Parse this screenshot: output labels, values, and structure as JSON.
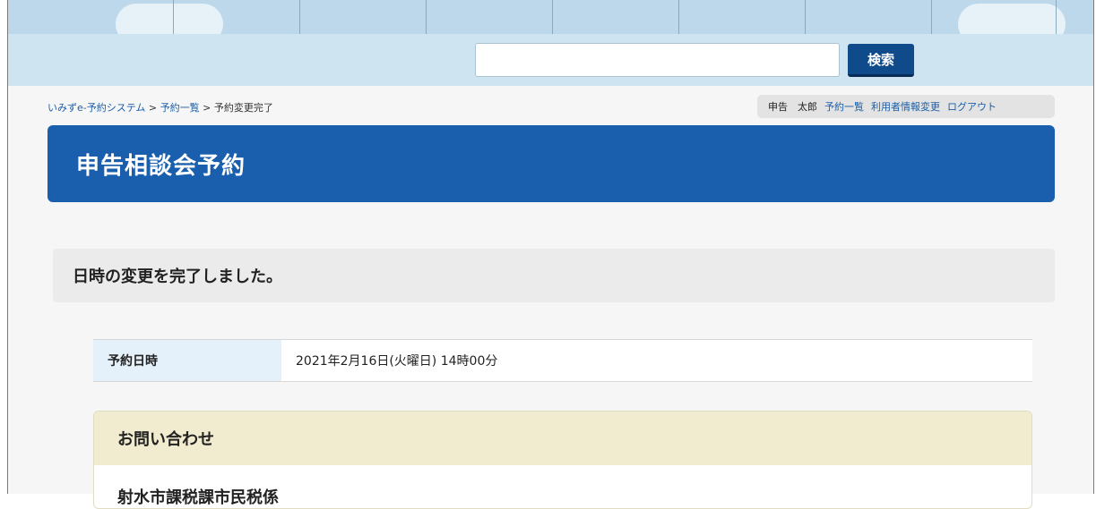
{
  "search": {
    "value": "",
    "button_label": "検索"
  },
  "breadcrumb": {
    "items": [
      "いみずe-予約システム",
      "予約一覧",
      "予約変更完了"
    ],
    "separator": ">"
  },
  "user_bar": {
    "user_name": "申告　太郎",
    "links": [
      "予約一覧",
      "利用者情報変更",
      "ログアウト"
    ]
  },
  "page": {
    "title": "申告相談会予約",
    "message": "日時の変更を完了しました。"
  },
  "detail": {
    "label": "予約日時",
    "value": "2021年2月16日(火曜日) 14時00分"
  },
  "contact": {
    "title": "お問い合わせ",
    "department": "射水市課税課市民税係"
  },
  "colors": {
    "header_blue": "#1a5fad",
    "search_button": "#0f4a8a",
    "link_blue": "#1b5ea8",
    "contact_header": "#f1ebcf"
  }
}
